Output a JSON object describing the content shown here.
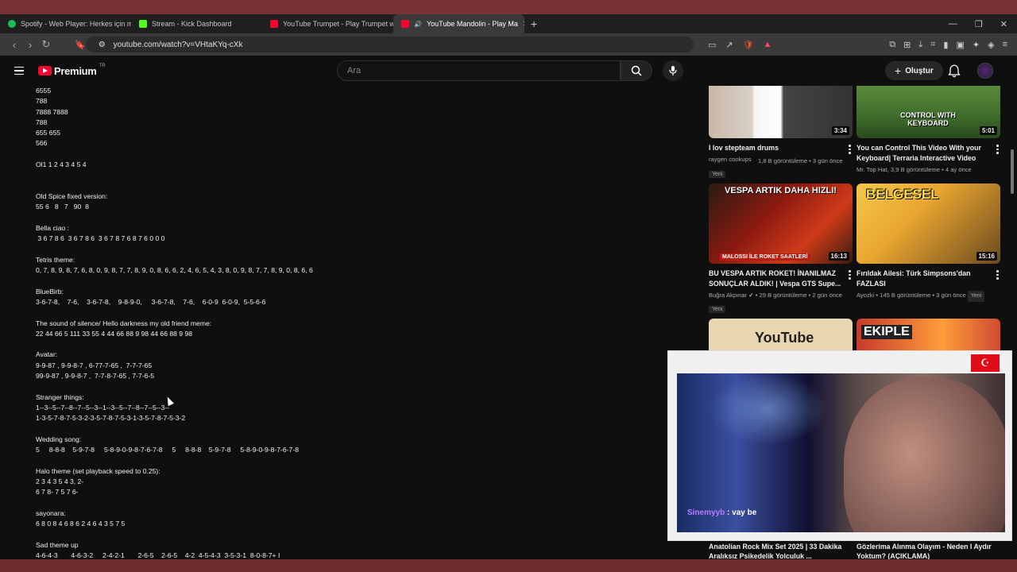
{
  "browser": {
    "tabs": [
      {
        "label": "Spotify - Web Player: Herkes için mü",
        "fav_color": "#1db954"
      },
      {
        "label": "Stream - Kick Dashboard",
        "fav_color": "#53fc18"
      },
      {
        "label": "YouTube Trumpet - Play Trumpet wit",
        "fav_color": "#ff0033"
      },
      {
        "label": "YouTube Mandolin - Play Ma",
        "fav_color": "#ff0033"
      }
    ],
    "url": "youtube.com/watch?v=VHtaKYq-cXk"
  },
  "header": {
    "logo_text": "Premium",
    "region": "TR",
    "search_placeholder": "Ara",
    "create_label": "Oluştur"
  },
  "description_lines": [
    "6555",
    "788",
    "7888 7888",
    "788",
    "655 655",
    "566",
    "",
    "Ol1 1 2 4 3 4 5 4",
    "",
    "",
    "Old Spice fixed version:",
    "55 6   8   7   90  8",
    "",
    "Bella ciao :",
    " 3 6 7 8 6  3 6 7 8 6  3 6 7 8 7 6 8 7 6 0 0 0",
    "",
    "Tetris theme:",
    "0, 7, 8, 9, 8, 7, 6, 8, 0, 9, 8, 7, 7, 8, 9, 0, 8, 6, 6, 2, 4, 6, 5, 4, 3, 8, 0, 9, 8, 7, 7, 8, 9, 0, 8, 6, 6",
    "",
    "BlueBirb:",
    "3-6-7-8,    7-6,    3-6-7-8,    9-8-9-0,     3-6-7-8,    7-6,    6-0-9  6-0-9,  5-5-6-6",
    "",
    "The sound of silence/ Hello darkness my old friend meme:",
    "22 44 66 5 111 33 55 4 44 66 88 9 98 44 66 88 9 98",
    "",
    "Avatar:",
    "9-9-87 , 9-9-8-7 , 6-77-7-65 ,  7-7-7-65",
    "99-9-87 , 9-9-8-7 ,  7-7-8-7-65 , 7-7-6-5",
    "",
    "Stranger things:",
    "1--3--5--7--8--7--5--3--1--3--5--7--8--7--5--3--",
    "1-3-5-7-8-7-5-3-2-3-5-7-8-7-5-3-1-3-5-7-8-7-5-3-2",
    "",
    "Wedding song:",
    "5     8-8-8    5-9-7-8     5-8-9-0-9-8-7-6-7-8     5     8-8-8    5-9-7-8     5-8-9-0-9-8-7-6-7-8",
    "",
    "Halo theme (set playback speed to 0.25):",
    "2 3 4 3 5 4 3, 2-",
    "6 7 8- 7 5 7 6-",
    "",
    "sayonara:",
    "6 8 0 8 4 6 8 6 2 4 6 4 3 5 7 5",
    "",
    "Sad theme up",
    "4-6-4-3       4-6-3-2     2-4-2-1       2-6-5    2-6-5    4-2  4-5-4-3  3-5-3-1  8-0-8-7+ I"
  ],
  "recommendations": [
    {
      "title": "I lov stepteam drums",
      "channel": "raygen cookups",
      "meta": "1,8 B görüntüleme • 3 gün önce",
      "badge": "Yeni",
      "duration": "3:34"
    },
    {
      "title": "You can Control This Video With your Keyboard| Terraria Interactive Video",
      "channel": "Mr. Top Hat",
      "meta": "3,9 B görüntüleme • 4 ay önce",
      "badge": "",
      "duration": "5:01",
      "thumb_text": "CONTROL WITH KEYBOARD"
    },
    {
      "title": "BU VESPA ARTIK ROKET! İNANILMAZ SONUÇLAR ALDIK! | Vespa GTS Supe...",
      "channel": "Buğra Akpınar",
      "meta": "29 B görüntüleme • 2 gün önce",
      "badge": "Yeni",
      "duration": "16:13",
      "thumb_text": "VESPA ARTIK DAHA HIZLI!",
      "thumb_sub": "MALOSSI İLE ROKET SAATLERİ"
    },
    {
      "title": "Fırıldak Ailesi: Türk Simpsons'dan FAZLASI",
      "channel": "Ayozki",
      "meta": "145 B görüntüleme • 3 gün önce",
      "badge": "Yeni",
      "duration": "15:16",
      "thumb_text": "BELGESEL"
    },
    {
      "title": "",
      "thumb_text": "YouTube"
    },
    {
      "title": "",
      "thumb_text": "EKIPLE"
    }
  ],
  "bottom_peek": [
    {
      "title": "Anatolian Rock Mix Set 2025 | 33 Dakika Aralıksız Psikedelik Yolculuk ..."
    },
    {
      "title": "Gözlerima Alınma Olayım - Neden I Aydır Yoktum? (AÇIKLAMA)"
    }
  ],
  "stream_overlay": {
    "chat_user": "Sinemyyb",
    "chat_message": ": vay be",
    "flag": "☪"
  }
}
